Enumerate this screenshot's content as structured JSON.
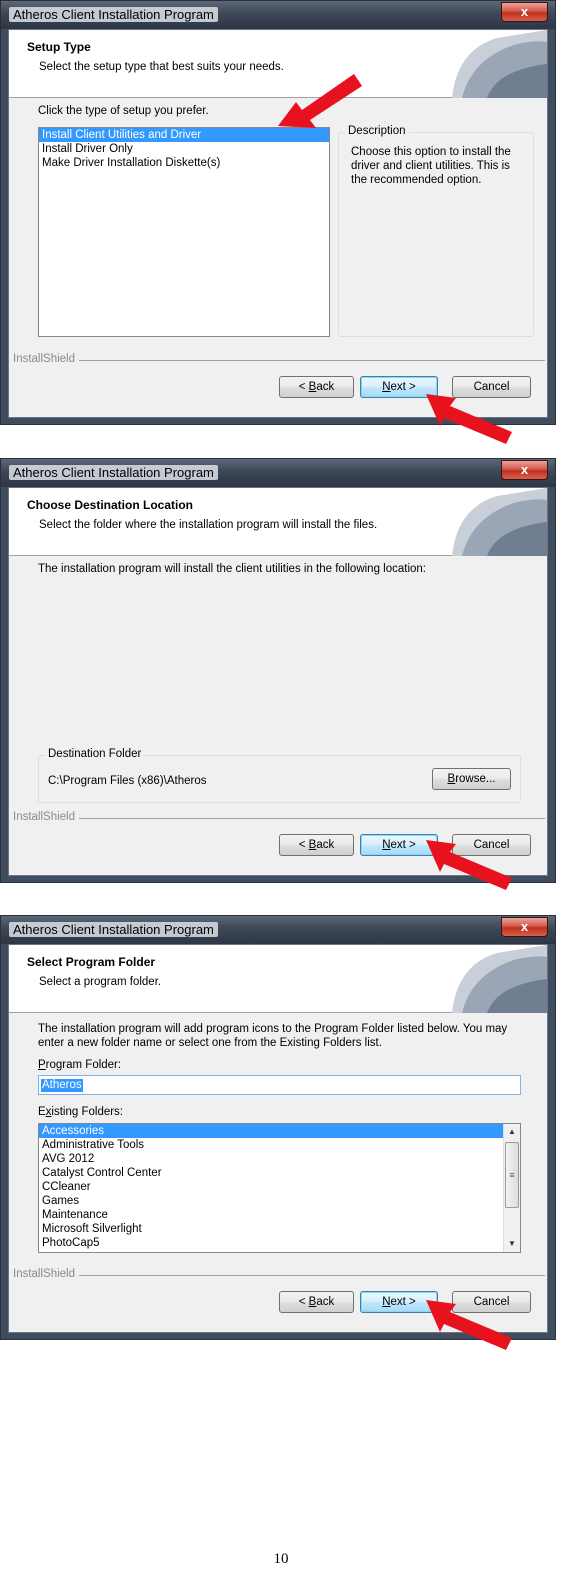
{
  "window_title": "Atheros Client Installation Program",
  "close_glyph": "x",
  "installshield_label": "InstallShield",
  "buttons": {
    "back": "< Back",
    "next": "Next >",
    "cancel": "Cancel",
    "browse": "Browse..."
  },
  "dialog1": {
    "title": "Setup Type",
    "subtitle": "Select the setup type that best suits your needs.",
    "prompt": "Click the type of setup you prefer.",
    "options": [
      "Install Client Utilities and Driver",
      "Install Driver Only",
      "Make Driver Installation Diskette(s)"
    ],
    "selected_option": "Install Client Utilities and Driver",
    "description_label": "Description",
    "description_text": "Choose this option to install the driver and client utilities. This is the recommended option."
  },
  "dialog2": {
    "title": "Choose Destination Location",
    "subtitle": "Select the folder where the installation program will install the files.",
    "prompt": "The installation program will install the client utilities in the following location:",
    "destination_label": "Destination Folder",
    "destination_path": "C:\\Program Files (x86)\\Atheros"
  },
  "dialog3": {
    "title": "Select Program Folder",
    "subtitle": "Select a program folder.",
    "prompt_line1": "The installation program will add program icons to the Program Folder listed below. You may",
    "prompt_line2": "enter a new folder name or select one from the Existing Folders list.",
    "program_folder_label": "Program Folder:",
    "program_folder_value": "Atheros",
    "existing_folders_label": "Existing Folders:",
    "existing_folders": [
      "Accessories",
      "Administrative Tools",
      "AVG 2012",
      "Catalyst Control Center",
      "CCleaner",
      "Games",
      "Maintenance",
      "Microsoft Silverlight",
      "PhotoCap5"
    ],
    "selected_folder": "Accessories"
  },
  "annotation_color": "#e8121e",
  "page_number": "10"
}
